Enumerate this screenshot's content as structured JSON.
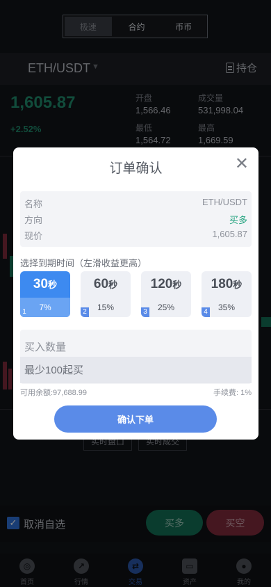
{
  "segment_tabs": [
    {
      "label": "极速",
      "active": true
    },
    {
      "label": "合约",
      "active": false
    },
    {
      "label": "币币",
      "active": false
    }
  ],
  "pair": {
    "symbol": "ETH/USDT",
    "hold_label": "持仓"
  },
  "ticker": {
    "price": "1,605.87",
    "change": "+2.52%",
    "open_label": "开盘",
    "open": "1,566.46",
    "volume_label": "成交量",
    "volume": "531,998.04",
    "low_label": "最低",
    "low": "1,564.72",
    "high_label": "最高",
    "high": "1,669.59"
  },
  "background_buttons": {
    "left": "实时盘口",
    "right": "实时成交"
  },
  "watchlist": {
    "label": "取消自选",
    "checked": true
  },
  "actions": {
    "buy": "买多",
    "sell": "买空"
  },
  "tabbar": [
    {
      "label": "首页",
      "icon": "home-icon",
      "active": false
    },
    {
      "label": "行情",
      "icon": "chart-icon",
      "active": false
    },
    {
      "label": "交易",
      "icon": "trade-icon",
      "active": true
    },
    {
      "label": "资产",
      "icon": "wallet-icon",
      "active": false
    },
    {
      "label": "我的",
      "icon": "user-icon",
      "active": false
    }
  ],
  "dialog": {
    "title": "订单确认",
    "info": [
      {
        "key": "名称",
        "value": "ETH/USDT"
      },
      {
        "key": "方向",
        "value": "买多"
      },
      {
        "key": "现价",
        "value": "1,605.87"
      }
    ],
    "expire_label": "选择到期时间（左滑收益更高）",
    "options": [
      {
        "seconds": "30",
        "unit": "秒",
        "rate": "7%",
        "index": "1",
        "active": true
      },
      {
        "seconds": "60",
        "unit": "秒",
        "rate": "15%",
        "index": "2",
        "active": false
      },
      {
        "seconds": "120",
        "unit": "秒",
        "rate": "25%",
        "index": "3",
        "active": false
      },
      {
        "seconds": "180",
        "unit": "秒",
        "rate": "35%",
        "index": "4",
        "active": false
      }
    ],
    "qty_label": "买入数量",
    "qty_placeholder": "最少100起买",
    "balance": "可用余额:97,688.99",
    "fee": "手续费: 1%",
    "confirm": "确认下单"
  },
  "colors": {
    "accent": "#5a8be8",
    "green": "#1fa17c",
    "red": "#7e2a3b"
  }
}
